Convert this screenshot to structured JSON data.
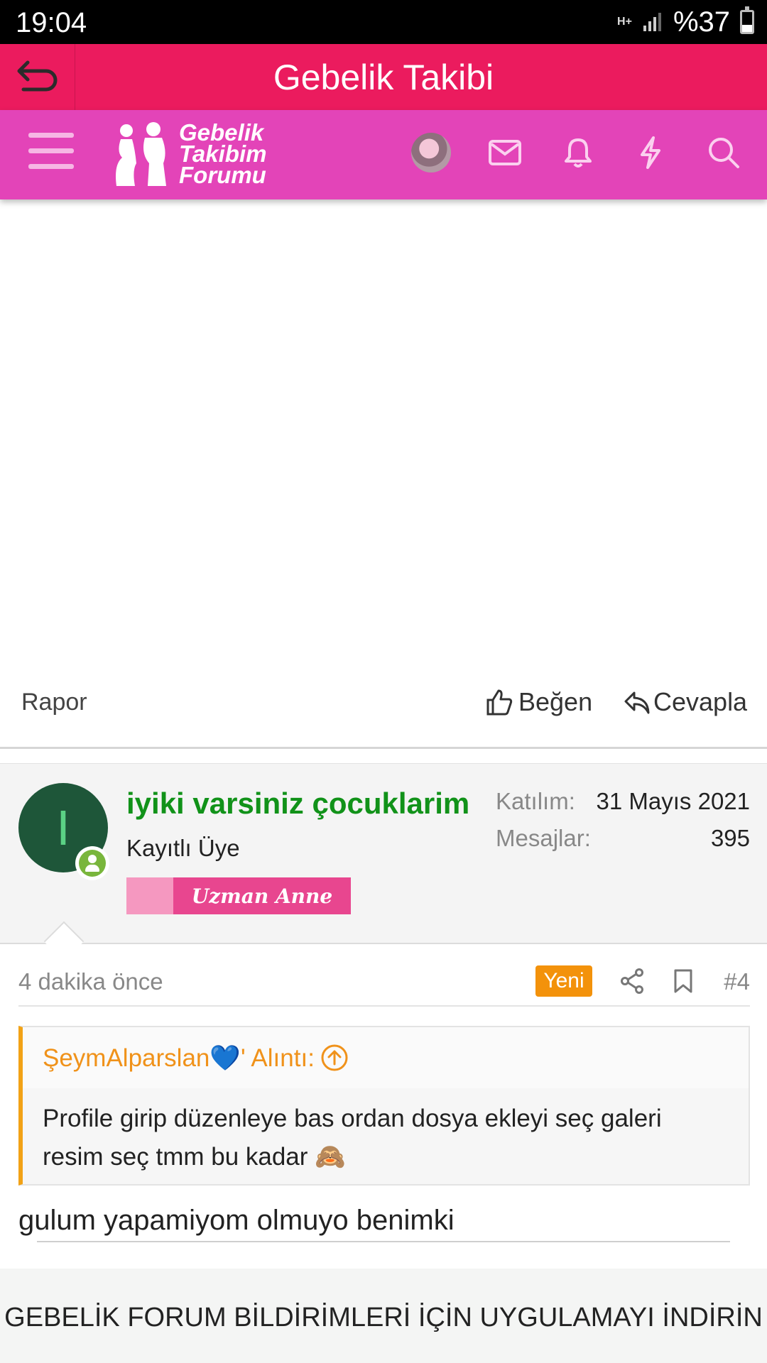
{
  "status_bar": {
    "time": "19:04",
    "network": "H+",
    "battery": "%37",
    "battery_level": 0.37
  },
  "app_bar": {
    "title": "Gebelik Takibi",
    "back_icon": "undo-arrow-icon"
  },
  "forum_header": {
    "logo_lines": [
      "Gebelik",
      "Takibim",
      "Forumu"
    ],
    "icons": [
      "menu-icon",
      "avatar",
      "mail-icon",
      "bell-icon",
      "lightning-icon",
      "search-icon"
    ]
  },
  "post_actions": {
    "report": "Rapor",
    "like": "Beğen",
    "reply": "Cevapla"
  },
  "user": {
    "initial": "I",
    "name": "iyiki varsiniz çocuklarim",
    "role": "Kayıtlı Üye",
    "banner": "Uzman Anne",
    "joined_label": "Katılım:",
    "joined_value": "31 Mayıs 2021",
    "messages_label": "Mesajlar:",
    "messages_value": "395"
  },
  "message": {
    "time": "4 dakika önce",
    "badge": "Yeni",
    "number": "#4",
    "quote_author": "ŞeymAlparslan💙' Alıntı:",
    "quote_text": "Profile girip düzenleye bas ordan dosya ekleyi seç galeri resim seç tmm bu kadar 🙈",
    "text": "gulum yapamiyom olmuyo benimki"
  },
  "footer": {
    "text": "GEBELİK FORUM BİLDİRİMLERİ İÇİN UYGULAMAYI İNDİRİN"
  },
  "colors": {
    "app_bar": "#eb1b5e",
    "forum_bar": "#e344b8",
    "username": "#119219",
    "accent": "#f3920b"
  }
}
